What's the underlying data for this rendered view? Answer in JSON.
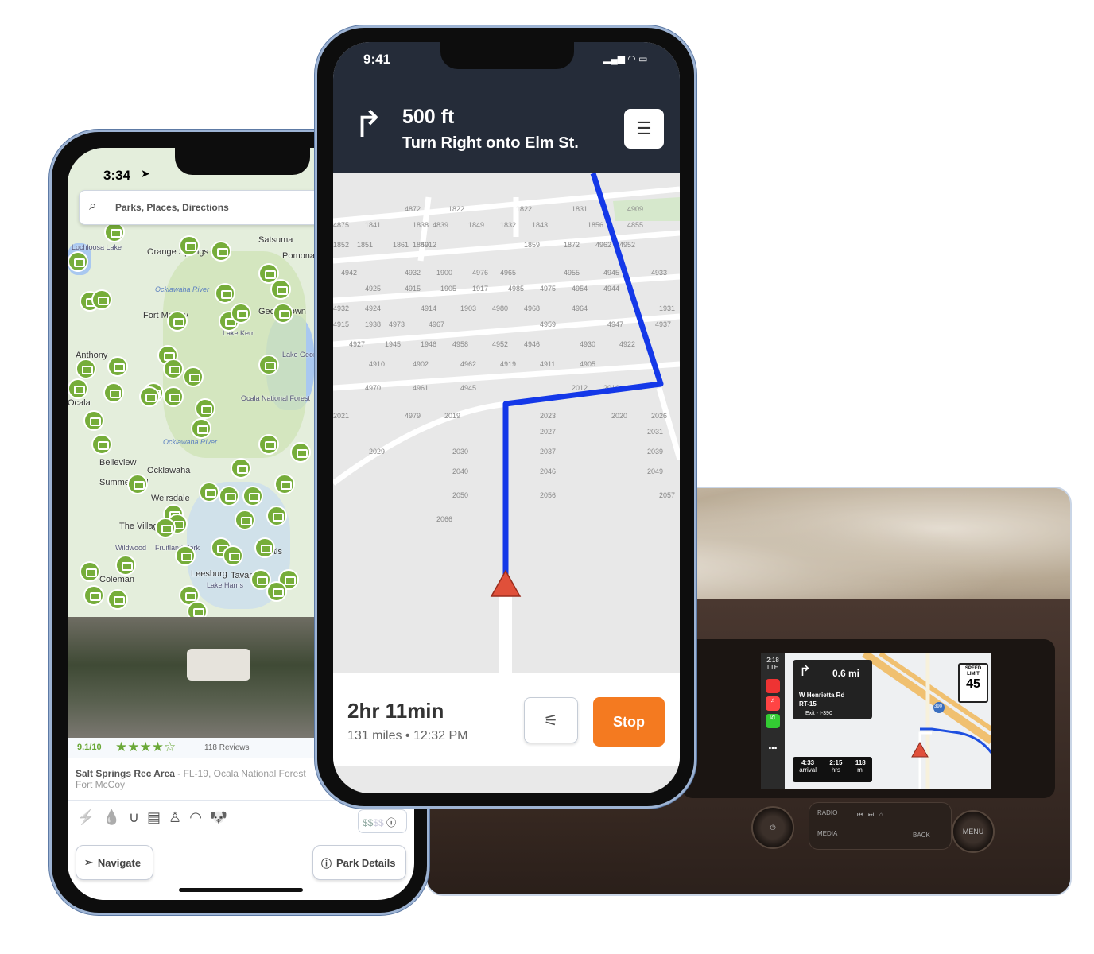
{
  "left_phone": {
    "status_time": "3:34",
    "search_placeholder": "Parks, Places, Directions",
    "map_labels": [
      "Satsuma",
      "Orange Springs",
      "Pomona Park",
      "Fort McCoy",
      "Georgetown",
      "Anthony",
      "Ocala",
      "Belleview",
      "Ocklawaha",
      "Summerfield",
      "Weirsdale",
      "The Villages",
      "Leesburg",
      "Coleman",
      "Tavares",
      "Eustis",
      "Lochloosa Lake",
      "Lake George",
      "Lake Kerr",
      "Lake Harris",
      "Ocala National Forest",
      "Fruitland Park",
      "Wildwood"
    ],
    "water_labels": [
      "Ocklawaha River",
      "Ocklawaha River"
    ],
    "rating": "9.1/10",
    "stars": 4,
    "reviews": "118 Reviews",
    "park_name": "Salt Springs Rec Area",
    "park_address": " - FL-19, Ocala National Forest",
    "park_city": "Fort McCoy",
    "amenities": [
      "50-amp-icon",
      "water-icon",
      "sewer-icon",
      "bus-icon",
      "toilet-icon",
      "wifi-icon",
      "pets-icon"
    ],
    "price": {
      "active": "$$",
      "inactive": "$$"
    },
    "navigate_label": "Navigate",
    "details_label": "Park Details"
  },
  "center_phone": {
    "status_time": "9:41",
    "distance": "500 ft",
    "instruction": "Turn Right onto Elm St.",
    "street_numbers": [
      "4872",
      "1822",
      "1822",
      "1831",
      "4909",
      "4875",
      "1841",
      "1838",
      "4839",
      "1849",
      "1832",
      "1843",
      "1856",
      "4855",
      "1852",
      "1851",
      "1861",
      "1860",
      "4912",
      "1859",
      "1872",
      "4962",
      "4952",
      "4942",
      "4932",
      "1900",
      "4976",
      "4965",
      "4955",
      "4945",
      "4933",
      "4925",
      "4915",
      "1905",
      "1917",
      "4985",
      "4975",
      "4954",
      "4944",
      "4932",
      "4924",
      "4914",
      "1903",
      "4980",
      "4968",
      "4964",
      "1931",
      "4915",
      "1938",
      "4973",
      "4967",
      "4959",
      "4947",
      "4937",
      "4927",
      "1945",
      "1946",
      "4958",
      "4952",
      "4946",
      "4930",
      "4922",
      "4910",
      "4902",
      "4962",
      "4919",
      "4911",
      "4905",
      "4970",
      "4961",
      "4945",
      "2012",
      "2016",
      "2017",
      "2021",
      "4979",
      "2019",
      "2023",
      "2020",
      "2026",
      "2027",
      "2031",
      "2029",
      "2030",
      "2037",
      "2039",
      "2040",
      "2046",
      "2049",
      "2050",
      "2056",
      "2057",
      "2066"
    ],
    "eta_duration": "2hr 11min",
    "eta_details": "131 miles • 12:32 PM",
    "stop_label": "Stop",
    "route_color": "#1438e8",
    "accent_color": "#f47a20"
  },
  "carplay": {
    "time": "2:18",
    "signal": "LTE",
    "distance": "0.6 mi",
    "street": "W Henrietta Rd",
    "route": "RT-15",
    "exit": "Exit  - I-390",
    "shield": "390",
    "arrival": "4:33",
    "arrival_label": "arrival",
    "hrs": "2:15",
    "hrs_label": "hrs",
    "mi": "118",
    "mi_label": "mi",
    "speed_label": "SPEED LIMIT",
    "speed": "45",
    "radio_labels": [
      "RADIO",
      "MEDIA",
      "BACK",
      "MENU"
    ]
  }
}
